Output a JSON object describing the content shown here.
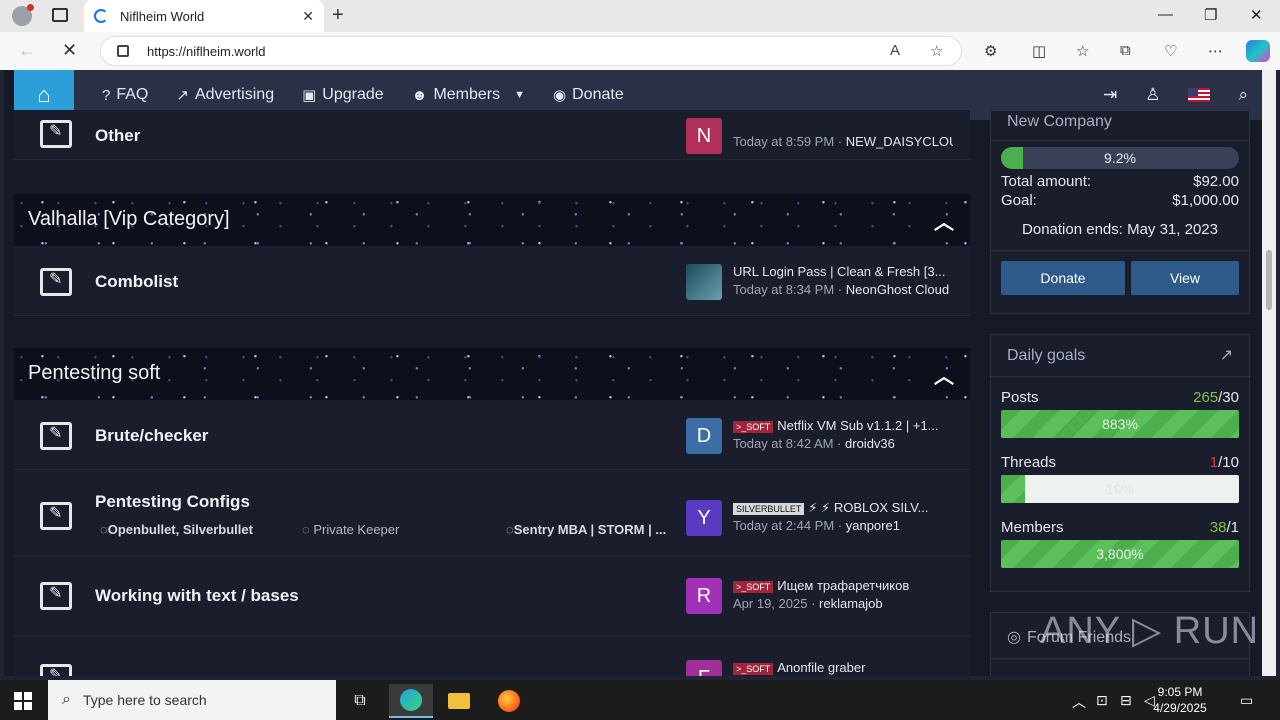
{
  "browser": {
    "tab_title": "Niflheim World",
    "url": "https://niflheim.world",
    "new_tab_symbol": "+",
    "close_symbol": "✕"
  },
  "navbar": {
    "items": [
      {
        "label": "FAQ",
        "icon": "question-circle-icon"
      },
      {
        "label": "Advertising",
        "icon": "chart-line-icon"
      },
      {
        "label": "Upgrade",
        "icon": "gift-icon"
      },
      {
        "label": "Members",
        "icon": "users-icon"
      },
      {
        "label": "Donate",
        "icon": "money-icon"
      }
    ]
  },
  "forums": {
    "other": {
      "title": "Other",
      "avatar_letter": "N",
      "avatar_color": "#b0305a",
      "meta_time": "Today at 8:59 PM",
      "meta_user": "NEW_DAISYCLOU"
    },
    "cat_valhalla": "Valhalla [Vip Category]",
    "combolist": {
      "title": "Combolist",
      "last_title": "URL Login Pass | Clean & Fresh [3...",
      "meta_time": "Today at 8:34 PM",
      "meta_user": "NeonGhost Cloud"
    },
    "cat_pentesting": "Pentesting soft",
    "brute": {
      "title": "Brute/checker",
      "avatar_letter": "D",
      "avatar_color": "#3a6ea5",
      "prefix": ">_SOFT",
      "last_title": "Netflix VM Sub v1.1.2 | +1...",
      "meta_time": "Today at 8:42 AM",
      "meta_user": "droidv36"
    },
    "configs": {
      "title": "Pentesting Configs",
      "sub1": "Openbullet, Silverbullet",
      "sub2": "Private Keeper",
      "sub3": "Sentry MBA | STORM | ...",
      "avatar_letter": "Y",
      "avatar_color": "#5a3ac0",
      "prefix": "SILVERBULLET",
      "last_title": "⚡ ⚡ ROBLOX SILV...",
      "meta_time": "Today at 2:44 PM",
      "meta_user": "yanpore1"
    },
    "text_bases": {
      "title": "Working with text / bases",
      "avatar_letter": "R",
      "avatar_color": "#a030b8",
      "prefix": ">_SOFT",
      "last_title": "Ищем трафаретчиков",
      "meta_time": "Apr 19, 2025",
      "meta_user": "reklamajob"
    },
    "partial": {
      "avatar_letter": "F",
      "avatar_color": "#a03098",
      "prefix": ">_SOFT",
      "last_title": "Anonfile graber"
    }
  },
  "donation": {
    "header": "New Company",
    "percent_label": "9.2%",
    "percent": 9.2,
    "total_label": "Total amount:",
    "total_value": "$92.00",
    "goal_label": "Goal:",
    "goal_value": "$1,000.00",
    "ends": "Donation ends: May 31, 2023",
    "donate_btn": "Donate",
    "view_btn": "View"
  },
  "daily_goals": {
    "header": "Daily goals",
    "posts_label": "Posts",
    "posts_count": "265",
    "posts_goal": "/30",
    "posts_pct": "883%",
    "posts_fill": 100,
    "threads_label": "Threads",
    "threads_count": "1",
    "threads_goal": "/10",
    "threads_pct": "10%",
    "threads_fill": 10,
    "members_label": "Members",
    "members_count": "38",
    "members_goal": "/1",
    "members_pct": "3,800%",
    "members_fill": 100
  },
  "forum_friends": {
    "header": "Forum Friends"
  },
  "taskbar": {
    "search_placeholder": "Type here to search",
    "time": "9:05 PM",
    "date": "4/29/2025"
  },
  "watermark": "ANY ▷ RUN"
}
